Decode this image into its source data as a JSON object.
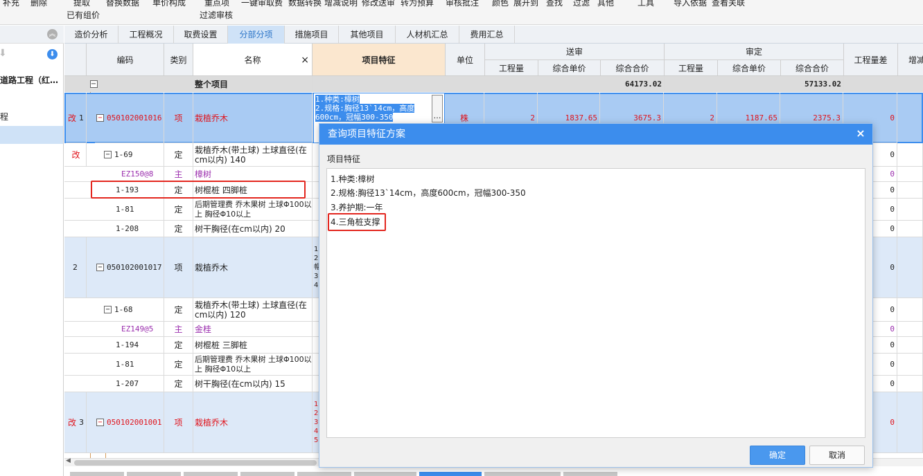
{
  "toolbar": {
    "items": [
      "补充",
      "删除",
      "提取",
      "已有组价",
      "替换数据",
      "单价构成",
      "重点项",
      "过滤审核",
      "一键审取费",
      "数据转换",
      "增减说明",
      "修改送审",
      "转为预算",
      "审核批注",
      "颜色",
      "展开到",
      "查找",
      "过滤",
      "其他",
      "工具",
      "导入依据",
      "查看关联"
    ]
  },
  "left_panel": {
    "tree_label": "道路工程（红…",
    "item_label": "程"
  },
  "tabs": [
    "造价分析",
    "工程概况",
    "取费设置",
    "分部分项",
    "措施项目",
    "其他项目",
    "人材机汇总",
    "费用汇总"
  ],
  "active_tab": "分部分项",
  "grid": {
    "headers": {
      "code": "编码",
      "type": "类别",
      "name": "名称",
      "name_close": "×",
      "feature": "项目特征",
      "unit": "单位",
      "submit": "送审",
      "audit": "审定",
      "qty": "工程量",
      "unit_price": "综合单价",
      "total": "综合合价",
      "qty_diff": "工程量差",
      "extra": "增减"
    },
    "whole": {
      "expander": "−",
      "name": "整个项目",
      "submit_total": "64173.02",
      "audit_total": "57133.02"
    },
    "rows": [
      {
        "mark": "改",
        "seq": "1",
        "code": "050102001016",
        "type": "项",
        "name": "栽植乔木",
        "feature": "1.种类:樟树 2.规格:胸径13`14cm，高度600cm，冠幅300-350",
        "unit": "株",
        "s_qty": "2",
        "s_price": "1837.65",
        "s_total": "3675.3",
        "a_qty": "2",
        "a_price": "1187.65",
        "a_total": "2375.3",
        "diff": "0"
      },
      {
        "mark": "改",
        "seq": "",
        "code": "1-69",
        "type": "定",
        "name": "栽植乔木(带土球) 土球直径(在cm以内) 140",
        "diff": "0"
      },
      {
        "mark": "",
        "seq": "",
        "code": "EZ150@8",
        "type": "主",
        "name": "樟树",
        "diff": "0"
      },
      {
        "mark": "",
        "seq": "",
        "code": "1-193",
        "type": "定",
        "name": "树棍桩 四脚桩",
        "diff": "0"
      },
      {
        "mark": "",
        "seq": "",
        "code": "1-81",
        "type": "定",
        "name": "后期管理费 乔木果树 土球Φ100以上 胸径Φ10以上",
        "diff": "0"
      },
      {
        "mark": "",
        "seq": "",
        "code": "1-208",
        "type": "定",
        "name": "树干胸径(在cm以内) 20",
        "diff": "0"
      },
      {
        "mark": "",
        "seq": "2",
        "code": "050102001017",
        "type": "项",
        "name": "栽植乔木",
        "feature": "1 2 帽 3 4",
        "diff": "0"
      },
      {
        "mark": "",
        "seq": "",
        "code": "1-68",
        "type": "定",
        "name": "栽植乔木(带土球) 土球直径(在cm以内) 120",
        "diff": "0"
      },
      {
        "mark": "",
        "seq": "",
        "code": "EZ149@5",
        "type": "主",
        "name": "金桂",
        "diff": "0"
      },
      {
        "mark": "",
        "seq": "",
        "code": "1-194",
        "type": "定",
        "name": "树棍桩 三脚桩",
        "diff": "0"
      },
      {
        "mark": "",
        "seq": "",
        "code": "1-81",
        "type": "定",
        "name": "后期管理费 乔木果树 土球Φ100以上 胸径Φ10以上",
        "diff": "0"
      },
      {
        "mark": "",
        "seq": "",
        "code": "1-207",
        "type": "定",
        "name": "树干胸径(在cm以内) 15",
        "diff": "0"
      },
      {
        "mark": "改",
        "seq": "3",
        "code": "050102001001",
        "type": "项",
        "name": "栽植乔木",
        "feature": "1 2 3 4 5",
        "diff": "0"
      }
    ],
    "feature_editor": {
      "line1": "1.种类:樟树",
      "line2": "2.规格:胸径13`14cm，高度",
      "line3": "600cm，冠幅300-350",
      "button": "…"
    }
  },
  "dialog": {
    "title": "查询项目特征方案",
    "close": "×",
    "label": "项目特征",
    "features": [
      "1.种类:樟树",
      "2.规格:胸径13`14cm，高度600cm，冠幅300-350",
      "3.养护期:一年",
      "4.三角桩支撑"
    ],
    "ok": "确定",
    "cancel": "取消"
  },
  "colors": {
    "accent": "#3c8ded",
    "highlight_red": "#e3261e",
    "mod_red": "#e0141c",
    "main_purple": "#9b2fae",
    "selected_row": "#a9cbf3",
    "item_row": "#dde9f8"
  }
}
